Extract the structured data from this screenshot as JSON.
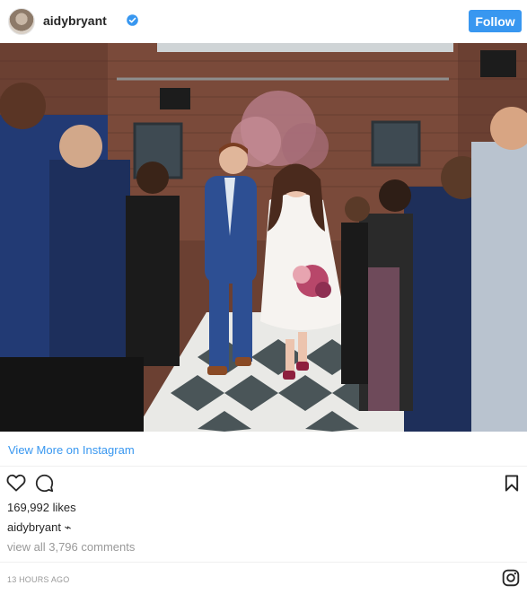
{
  "header": {
    "username": "aidybryant",
    "verified_icon": "verified-badge-icon",
    "follow_label": "Follow"
  },
  "post": {
    "image_icon": "wedding-photo",
    "view_more_label": "View More on Instagram",
    "likes": "169,992 likes",
    "caption_user": "aidybryant",
    "caption_emoji": "⌁",
    "comments_link": "view all 3,796 comments",
    "timestamp": "13 HOURS AGO"
  },
  "actions": {
    "like_icon": "heart-icon",
    "comment_icon": "comment-icon",
    "save_icon": "bookmark-icon",
    "logo_icon": "instagram-logo-icon"
  },
  "colors": {
    "accent": "#3897f0",
    "text": "#262626",
    "muted": "#999999"
  }
}
